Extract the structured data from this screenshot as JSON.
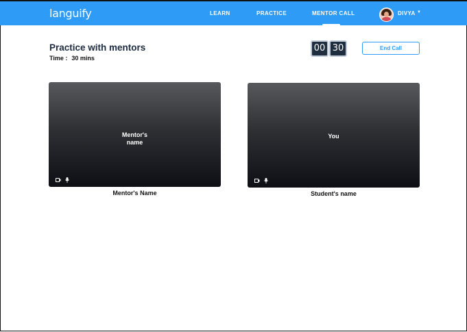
{
  "app": {
    "logo": "languify"
  },
  "nav": {
    "items": [
      {
        "label": "LEARN"
      },
      {
        "label": "PRACTICE"
      },
      {
        "label": "MENTOR CALL",
        "active": true
      }
    ],
    "user": {
      "name": "DIVYA"
    }
  },
  "header": {
    "title": "Practice with mentors",
    "time_label": "Time :",
    "time_value": "30 mins"
  },
  "timer": {
    "minutes": "00",
    "seconds": "30"
  },
  "actions": {
    "end_call": "End Call"
  },
  "videos": [
    {
      "overlay": "Mentor's\nname",
      "caption": "Mentor's Name"
    },
    {
      "overlay": "You",
      "caption": "Student's name"
    }
  ],
  "colors": {
    "brand": "#2e9bf6",
    "timer_bg": "#1f2e3f"
  }
}
